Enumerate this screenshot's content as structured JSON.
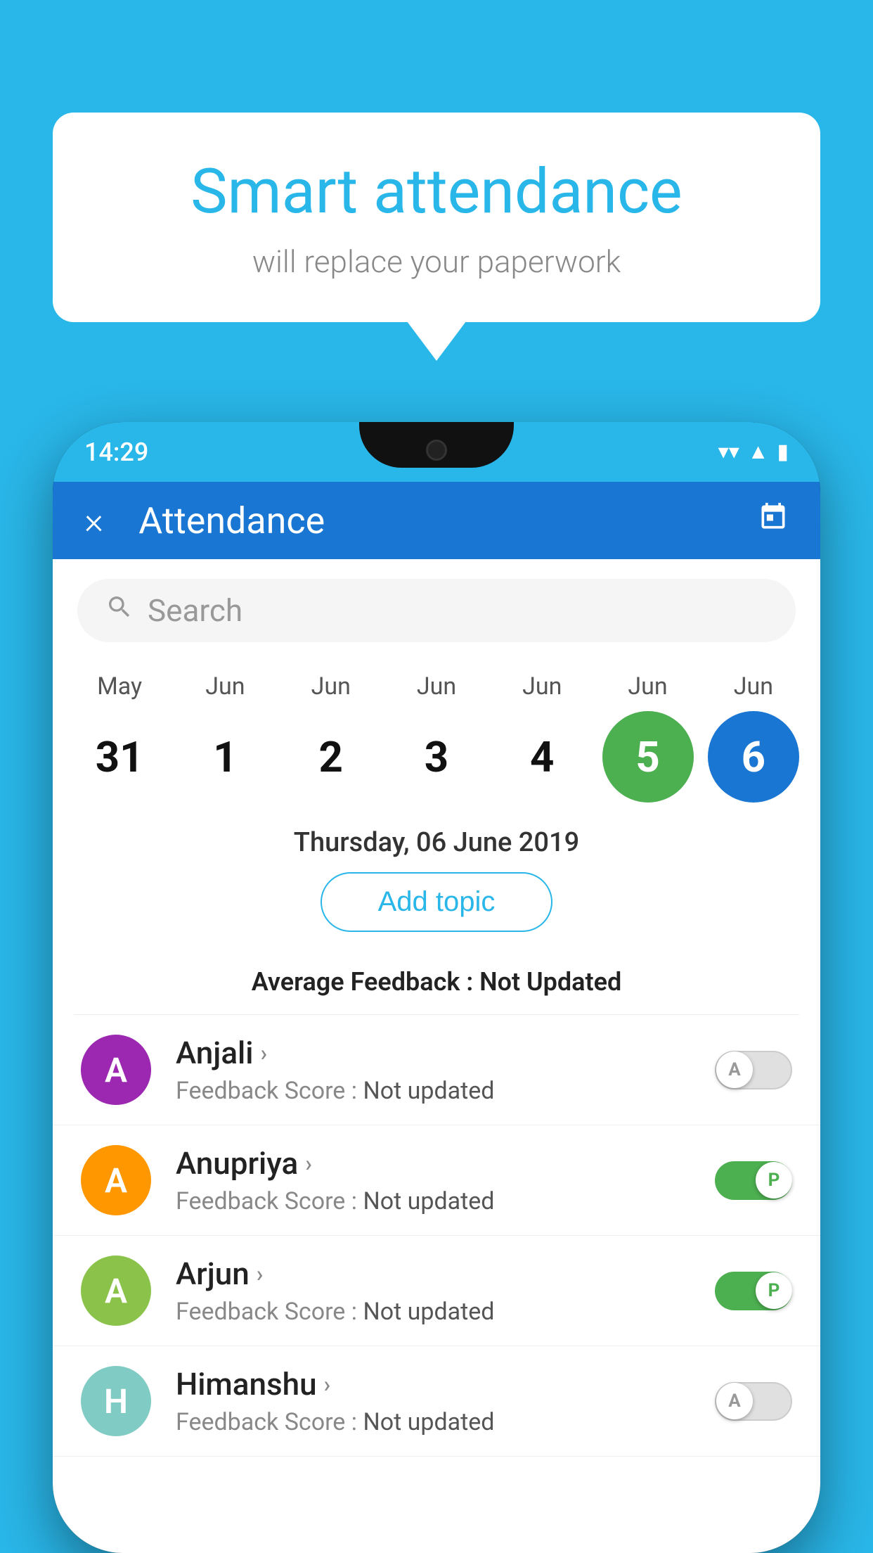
{
  "background_color": "#29b6e8",
  "bubble": {
    "title": "Smart attendance",
    "subtitle": "will replace your paperwork"
  },
  "status_bar": {
    "time": "14:29",
    "wifi": "▼",
    "signal": "▲",
    "battery": "▮"
  },
  "app_header": {
    "title": "Attendance",
    "close_label": "×",
    "calendar_icon": "📅"
  },
  "search": {
    "placeholder": "Search"
  },
  "calendar": {
    "months": [
      "May",
      "Jun",
      "Jun",
      "Jun",
      "Jun",
      "Jun",
      "Jun"
    ],
    "dates": [
      "31",
      "1",
      "2",
      "3",
      "4",
      "5",
      "6"
    ],
    "states": [
      "normal",
      "normal",
      "normal",
      "normal",
      "normal",
      "today",
      "selected"
    ]
  },
  "selected_date": "Thursday, 06 June 2019",
  "add_topic_label": "Add topic",
  "avg_feedback": {
    "label": "Average Feedback : ",
    "value": "Not Updated"
  },
  "students": [
    {
      "name": "Anjali",
      "avatar_letter": "A",
      "avatar_color": "purple",
      "feedback_label": "Feedback Score : ",
      "feedback_value": "Not updated",
      "toggle_state": "off",
      "toggle_label": "A"
    },
    {
      "name": "Anupriya",
      "avatar_letter": "A",
      "avatar_color": "orange",
      "feedback_label": "Feedback Score : ",
      "feedback_value": "Not updated",
      "toggle_state": "on",
      "toggle_label": "P"
    },
    {
      "name": "Arjun",
      "avatar_letter": "A",
      "avatar_color": "lightgreen",
      "feedback_label": "Feedback Score : ",
      "feedback_value": "Not updated",
      "toggle_state": "on",
      "toggle_label": "P"
    },
    {
      "name": "Himanshu",
      "avatar_letter": "H",
      "avatar_color": "teal",
      "feedback_label": "Feedback Score : ",
      "feedback_value": "Not updated",
      "toggle_state": "off",
      "toggle_label": "A"
    }
  ]
}
